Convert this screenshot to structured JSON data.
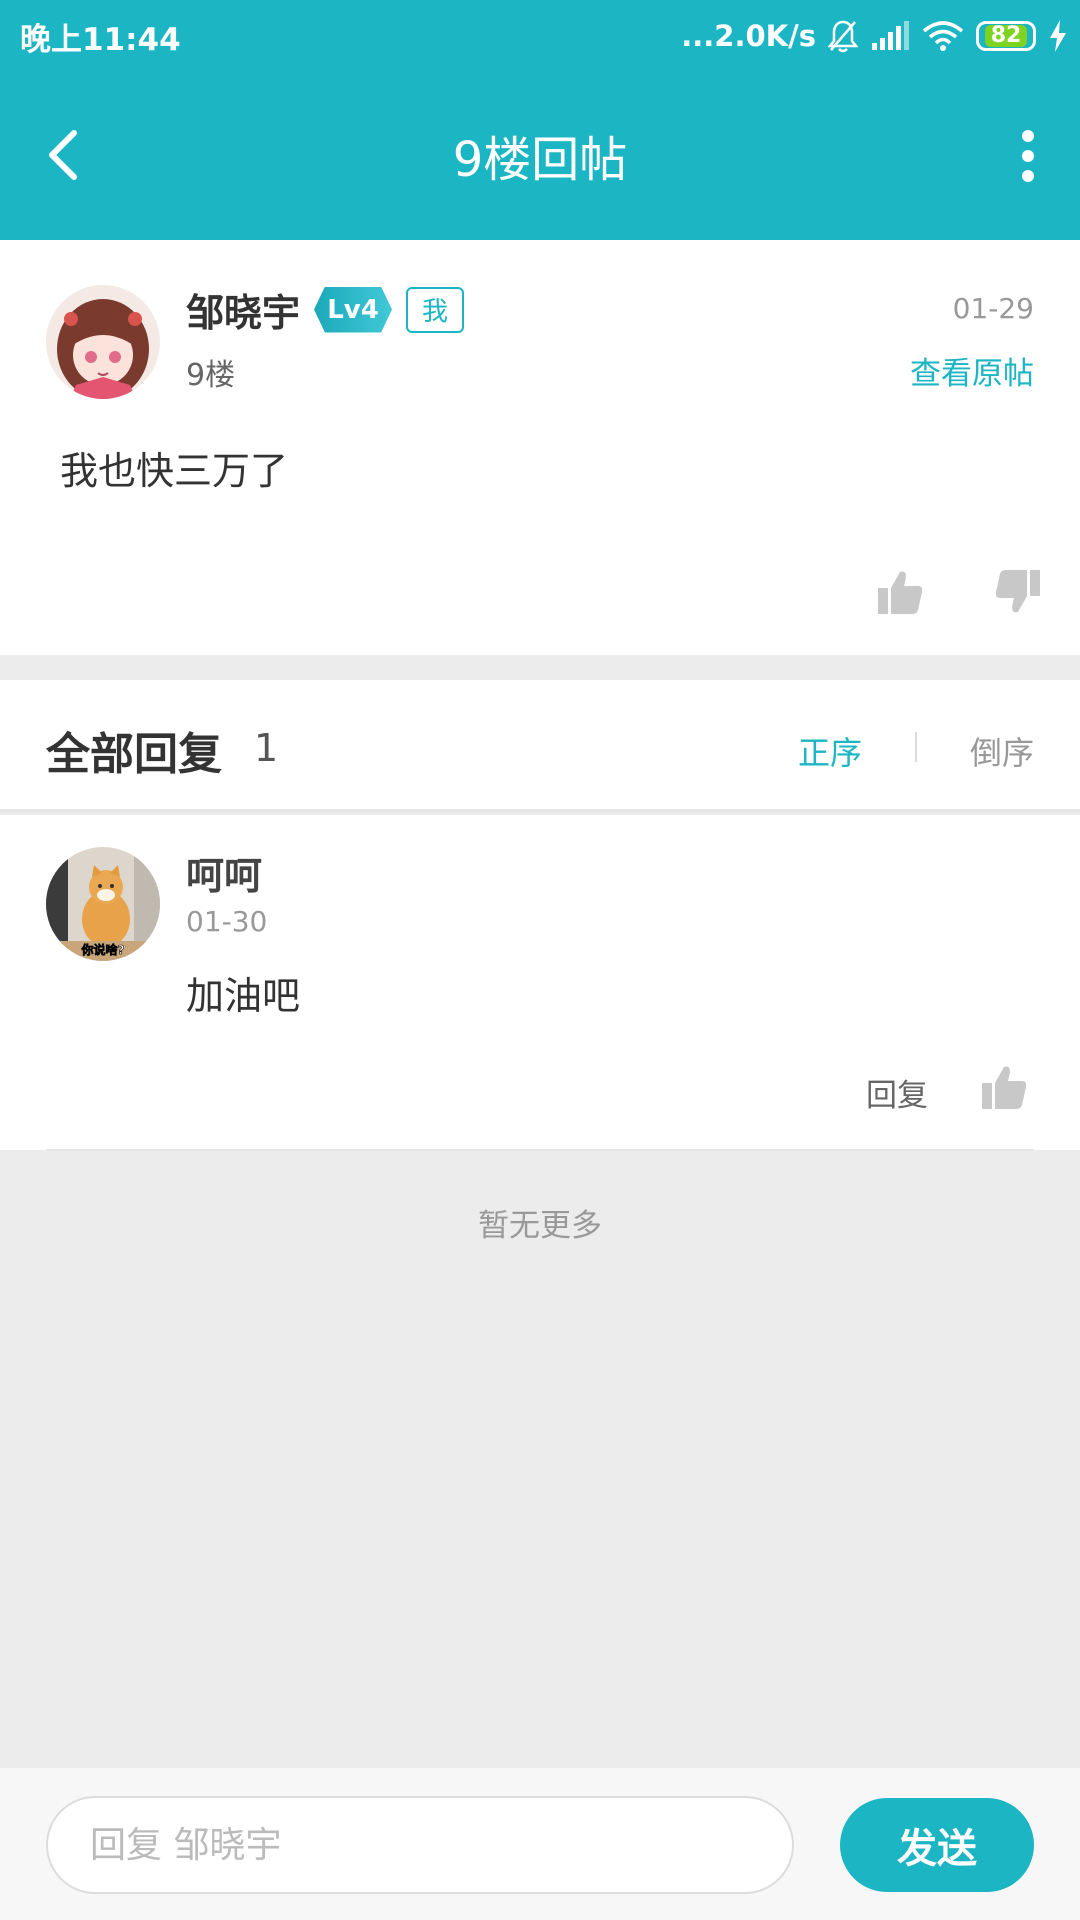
{
  "status_bar": {
    "time": "晚上11:44",
    "network_speed": "...2.0K/s",
    "battery": "82"
  },
  "toolbar": {
    "title": "9楼回帖"
  },
  "post": {
    "author": "邹晓宇",
    "level": "Lv4",
    "me_badge": "我",
    "floor": "9楼",
    "date": "01-29",
    "view_original": "查看原帖",
    "content": "我也快三万了"
  },
  "replies": {
    "title": "全部回复",
    "count": "1",
    "sort_asc": "正序",
    "sort_desc": "倒序",
    "items": [
      {
        "author": "呵呵",
        "date": "01-30",
        "content": "加油吧",
        "reply_label": "回复",
        "avatar_caption": "你说啥?"
      }
    ]
  },
  "no_more": "暂无更多",
  "input": {
    "placeholder": "回复 邹晓宇",
    "send_label": "发送"
  },
  "colors": {
    "accent": "#1bb5c4",
    "background": "#ececec"
  }
}
